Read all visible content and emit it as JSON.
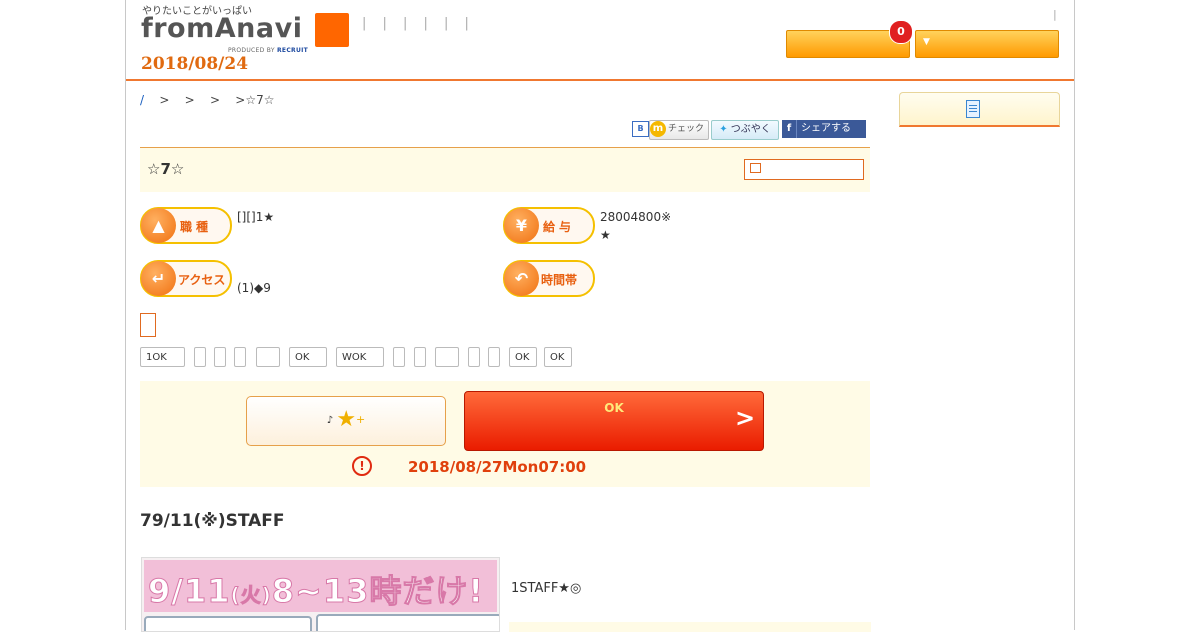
{
  "header": {
    "logo_tagline": "やりたいことがいっぱい",
    "logo_text_prefix": "from",
    "logo_text_a": "A",
    "logo_text_suffix": "navi",
    "logo_sub_prefix": "PRODUCED BY ",
    "logo_sub_brand": "RECRUIT",
    "nav_bars": "| | | | | |",
    "date": "2018/08/24",
    "separator": "|",
    "badge_count": "0",
    "dropdown_arrow": "▼"
  },
  "breadcrumb": {
    "home": "/",
    "sep1": ">",
    "sep2": ">",
    "sep3": ">",
    "sep4": ">",
    "current": "☆7☆"
  },
  "social": {
    "hatena": "B",
    "mixi_mark": "m",
    "mixi": "チェック",
    "twitter": "つぶやく",
    "facebook_f": "f",
    "facebook": "シェアする"
  },
  "job": {
    "title": "☆7☆",
    "shokushu_label": "職種",
    "shokushu_value": "[][]1★",
    "kyuyo_label": "給与",
    "kyuyo_line1": "28004800※",
    "kyuyo_line2": "★",
    "access_label": "アクセス",
    "access_value": "(1)◆9",
    "jikantai_label": "時間帯"
  },
  "tags": [
    "1OK",
    "",
    "",
    "",
    "",
    "OK",
    "WOK",
    "",
    "",
    "",
    "",
    "",
    "OK",
    "OK"
  ],
  "apply": {
    "keep_label": "♪",
    "keep_plus": "+",
    "apply_label": "OK",
    "apply_arrow": ">",
    "deadline_icon": "!",
    "deadline": "2018/08/27Mon07:00"
  },
  "catch_copy": "79/11(※)STAFF",
  "photo_text_main": "9/11",
  "photo_text_paren": "(火)",
  "photo_text_rest": "8~13時だけ!",
  "description": "1STAFF★◎",
  "colors": {
    "accent": "#ff6600",
    "date": "#e06a10",
    "deadline": "#e0400c",
    "panel_bg": "#fffbe6"
  },
  "icons": [
    "shirt-icon",
    "yen-icon",
    "walk-icon",
    "clock-icon",
    "doc-icon",
    "star-icon",
    "window-icon"
  ]
}
